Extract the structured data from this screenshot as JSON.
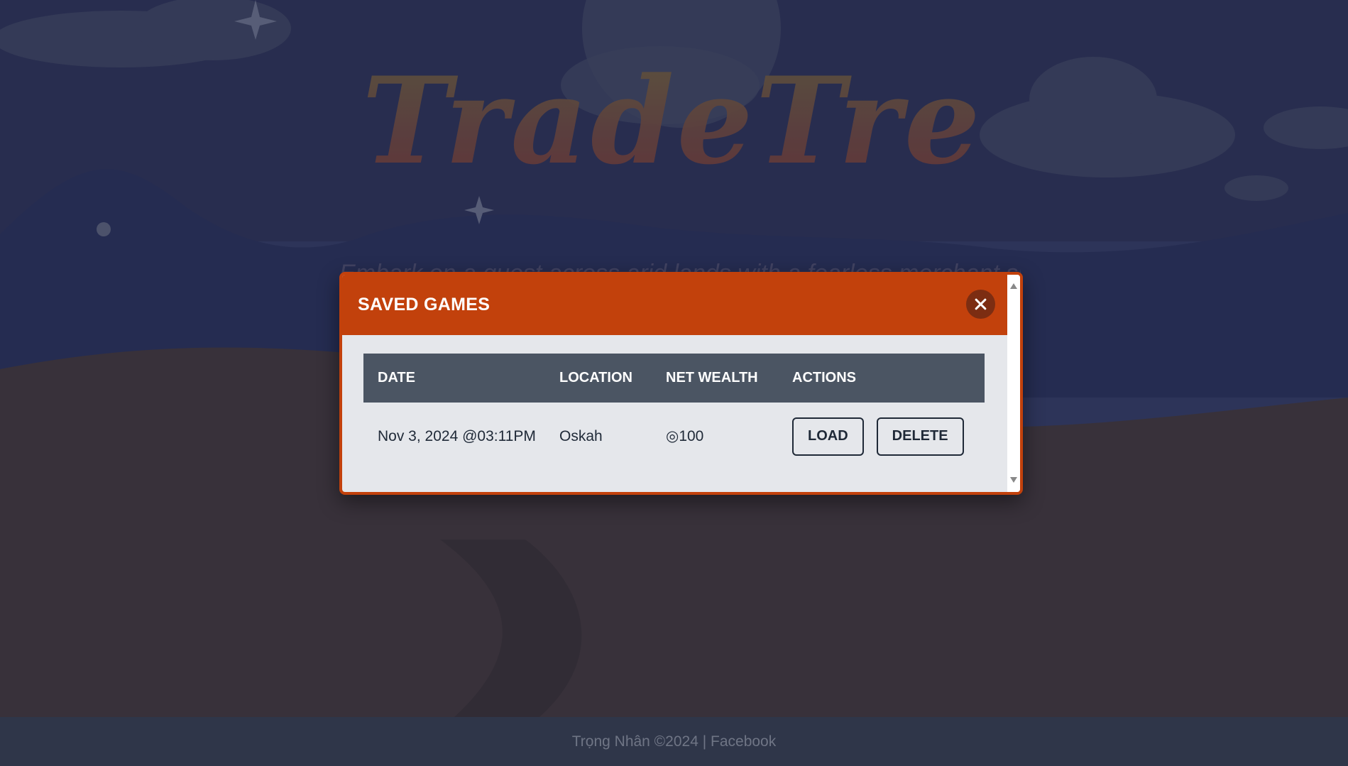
{
  "app": {
    "title": "TradeTrek",
    "tagline": "Embark on a quest across arid lands with a fearless merchant spirit"
  },
  "modal": {
    "title": "SAVED GAMES",
    "close_icon": "close-icon"
  },
  "table": {
    "headers": [
      "DATE",
      "LOCATION",
      "NET WEALTH",
      "ACTIONS"
    ],
    "rows": [
      {
        "date": "Nov 3, 2024 @03:11PM",
        "location": "Oskah",
        "net_wealth": "◎100",
        "load_label": "LOAD",
        "delete_label": "DELETE"
      }
    ]
  },
  "footer": {
    "credit": "Trọng Nhân ©2024 |",
    "link": "Facebook"
  },
  "colors": {
    "accent": "#c2410c",
    "header_bg": "#4b5563",
    "modal_bg": "#e5e7eb",
    "footer_bg": "#2f3649"
  }
}
